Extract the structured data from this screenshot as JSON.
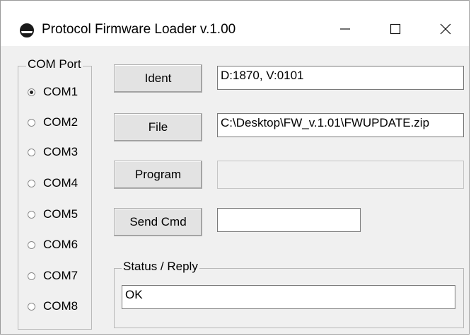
{
  "window": {
    "title": "Protocol Firmware Loader v.1.00",
    "icon": "app-icon"
  },
  "com_port": {
    "legend": "COM Port",
    "options": [
      "COM1",
      "COM2",
      "COM3",
      "COM4",
      "COM5",
      "COM6",
      "COM7",
      "COM8"
    ],
    "selected": "COM1"
  },
  "buttons": {
    "ident": "Ident",
    "file": "File",
    "program": "Program",
    "send_cmd": "Send Cmd"
  },
  "fields": {
    "ident_value": "D:1870, V:0101",
    "file_value": "C:\\Desktop\\FW_v.1.01\\FWUPDATE.zip",
    "program_value": "",
    "send_cmd_value": ""
  },
  "status": {
    "legend": "Status / Reply",
    "value": "OK"
  }
}
